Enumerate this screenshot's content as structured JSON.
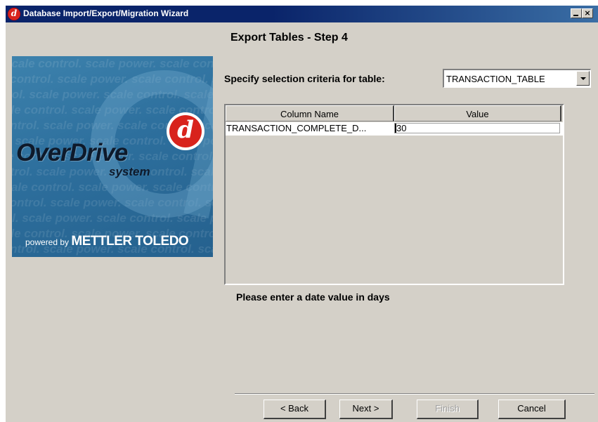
{
  "window": {
    "title": "Database Import/Export/Migration Wizard",
    "app_icon_letter": "d",
    "minimize_label": "_",
    "close_label": "×"
  },
  "step_title": "Export Tables - Step 4",
  "logo": {
    "product_name": "OverDrive",
    "product_sub": "system",
    "powered_by": "powered by",
    "vendor": "METTLER TOLEDO",
    "badge_letter": "d",
    "background_phrase": "scale control. scale power. scale control. scale power."
  },
  "criteria": {
    "label": "Specify selection criteria for table:",
    "selected_table": "TRANSACTION_TABLE"
  },
  "table": {
    "headers": [
      "Column Name",
      "Value"
    ],
    "rows": [
      {
        "column_name": "TRANSACTION_COMPLETE_D...",
        "value": "30"
      }
    ]
  },
  "hint": "Please enter a date value in days",
  "buttons": {
    "back": "< Back",
    "next": "Next >",
    "finish": "Finish",
    "cancel": "Cancel"
  },
  "colors": {
    "title_bar": "#0a246a",
    "dialog_bg": "#d4d0c8",
    "brand_red": "#d8231c",
    "logo_blue": "#2d6f9d"
  }
}
